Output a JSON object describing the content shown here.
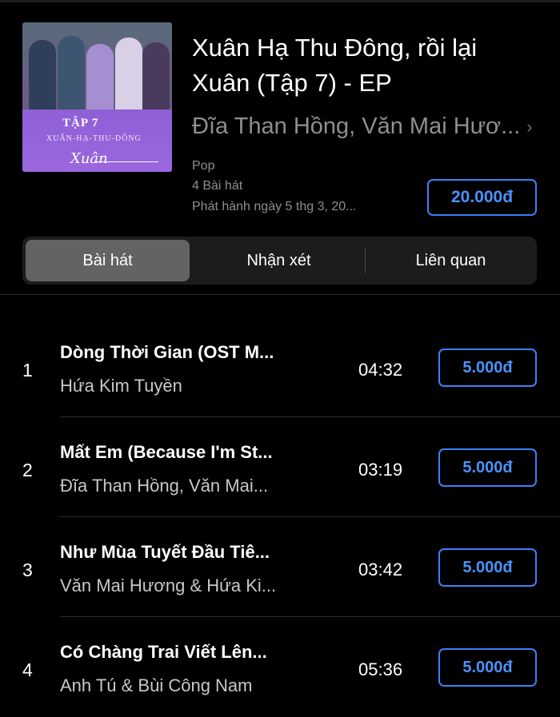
{
  "album": {
    "title": "Xuân Hạ Thu Đông, rồi lại Xuân (Tập 7) - EP",
    "artist": "Đĩa Than Hồng, Văn Mai Hươ...",
    "genre": "Pop",
    "track_count": "4 Bài hát",
    "release": "Phát hành ngày 5 thg 3, 20...",
    "price": "20.000đ",
    "cover": {
      "episode": "TẬP 7",
      "subtitle": "XUÂN-HẠ-THU-ĐÔNG",
      "script": "Xuân"
    }
  },
  "tabs": [
    {
      "label": "Bài hát",
      "active": true
    },
    {
      "label": "Nhận xét",
      "active": false
    },
    {
      "label": "Liên quan",
      "active": false
    }
  ],
  "tracks": [
    {
      "number": "1",
      "title": "Dòng Thời Gian (OST M...",
      "artist": "Hứa Kim Tuyền",
      "duration": "04:32",
      "price": "5.000đ"
    },
    {
      "number": "2",
      "title": "Mất Em (Because I'm St...",
      "artist": "Đĩa Than Hồng, Văn Mai...",
      "duration": "03:19",
      "price": "5.000đ"
    },
    {
      "number": "3",
      "title": "Như Mùa Tuyết Đầu Tiê...",
      "artist": "Văn Mai Hương & Hứa Ki...",
      "duration": "03:42",
      "price": "5.000đ"
    },
    {
      "number": "4",
      "title": "Có Chàng Trai Viết Lên...",
      "artist": "Anh Tú & Bùi Công Nam",
      "duration": "05:36",
      "price": "5.000đ"
    }
  ],
  "icons": {
    "artist_link": "chevron-right-icon"
  },
  "colors": {
    "accent": "#3a82f7",
    "background": "#000000",
    "secondary_text": "#8e8e93"
  }
}
